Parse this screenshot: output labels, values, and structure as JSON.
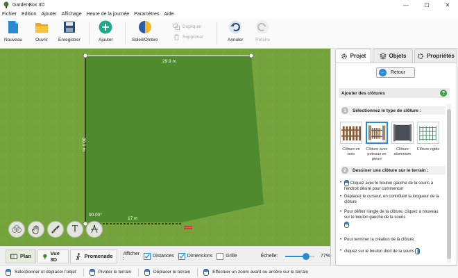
{
  "window": {
    "title": "GardenBox 3D",
    "controls": [
      "—",
      "☐",
      "✕"
    ]
  },
  "menu": [
    "Fichier",
    "Edition",
    "Ajouter",
    "Affichage",
    "Heure de la journée",
    "Paramètres",
    "Aide"
  ],
  "toolbar": {
    "nouveau": "Nouveau",
    "ouvrir": "Ouvrir",
    "enregistrer": "Enregistrer",
    "ajouter": "Ajouter",
    "soleil": "Soleil/Ombre",
    "dupliquer": "Dupliquer",
    "supprimer": "Supprimer",
    "annuler": "Annuler",
    "refaire": "Refaire"
  },
  "canvas": {
    "top_dim": "29.9 m",
    "left_dim": "30.1 m",
    "angle": "90.00°",
    "bottom_dim": "17 m"
  },
  "viewtabs": {
    "plan": "Plan",
    "vue3d": "Vue 3D",
    "promenade": "Promenade"
  },
  "display": {
    "label": "Afficher :",
    "distances": "Distances",
    "dimensions": "Dimensions",
    "grille": "Grille",
    "echelle": "Échelle:",
    "zoom": "77%",
    "zoom_fraction": 0.77
  },
  "status": {
    "select": "Sélectionner et déplacer l'objet",
    "pivot": "Pivoter le terrain",
    "move": "Déplacer le terrain",
    "zoom": "Effectuer un zoom avant ou arrière sur le terrain"
  },
  "panel": {
    "tabs": {
      "projet": "Projet",
      "objets": "Objets",
      "proprietes": "Propriétés"
    },
    "retour": "Retour",
    "section": "Ajouter des clôtures",
    "help": "?",
    "step1": {
      "num": "1",
      "title": "Sélectionnez le type de clôture :"
    },
    "fences": [
      {
        "label": "Clôture en bois"
      },
      {
        "label": "Clôture avec poteaux en pierre"
      },
      {
        "label": "Clôture aluminium"
      },
      {
        "label": "Clôture rigide"
      }
    ],
    "step2": {
      "num": "2",
      "title": "Dessiner une clôture sur le terrain :"
    },
    "instructions": {
      "i1": "Cliquez avec le bouton gauche de la souris à l'endroit désiré pour commencer",
      "i2": "Déplacez le curseur, en contrôlant la longueur de la clôture",
      "i3": "Pour définir l'angle de la clôture, cliquez à nouveau sur le bouton gauche de la souris",
      "i4": "Pour terminer la création de la clôture,",
      "i5": "cliquez sur le bouton droit de la souris"
    }
  },
  "colors": {
    "grass": "#76a43c",
    "terrain": "#4f8a2f",
    "accent": "#2a8cd0"
  }
}
